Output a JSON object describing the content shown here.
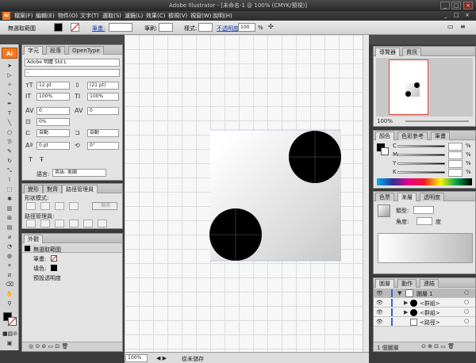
{
  "window": {
    "title": "Adobe Illustrator - [未命名-1 @ 100% (CMYK/預視)]",
    "minimize": "_",
    "maximize": "□",
    "close": "×"
  },
  "menubar": {
    "app_icon": "Ai",
    "items": [
      "檔案(F)",
      "編輯(E)",
      "物件(O)",
      "文字(T)",
      "選取(S)",
      "濾鏡(L)",
      "效果(C)",
      "檢視(V)",
      "視窗(W)",
      "說明(H)"
    ],
    "doc_min": "_",
    "doc_restore": "□",
    "doc_close": "×"
  },
  "controlbar": {
    "selection": "無選取範圍",
    "stroke_label": "筆畫:",
    "brush_label": "筆刷:",
    "style_label": "樣式:",
    "opacity_label": "不透明度:",
    "opacity_value": "100",
    "opacity_unit": "%"
  },
  "colors": {
    "accent": "#f47a20",
    "nav_frame": "#e0413a",
    "link": "#1d49b8"
  },
  "character_panel": {
    "tabs": [
      "字元",
      "段落",
      "OpenType"
    ],
    "font_family": "Adobe 明體 Std L",
    "font_style": "-",
    "size": "12 pt",
    "leading": "(21 pt)",
    "vscale": "100%",
    "hscale": "100%",
    "kerning": "0",
    "tracking": "0",
    "tsume": "0%",
    "aki_left": "自動",
    "aki_right": "自動",
    "baseline": "0 pt",
    "rotation": "0°",
    "language_label": "語言:",
    "language": "英語: 美國"
  },
  "pathfinder_panel": {
    "tabs": [
      "變形",
      "對齊",
      "路徑管理員"
    ],
    "shape_modes_label": "形狀模式:",
    "expand_label": "展開",
    "pathfinders_label": "路徑管理員:"
  },
  "appearance_panel": {
    "tab": "外觀",
    "header": "無選取範圍",
    "stroke_label": "筆畫:",
    "fill_label": "填色:",
    "default_opacity": "預設透明度"
  },
  "navigator_panel": {
    "tabs": [
      "導覽器",
      "資訊"
    ],
    "zoom": "100%"
  },
  "color_panel": {
    "tabs": [
      "顏色",
      "色彩參考",
      "筆畫"
    ],
    "channels": [
      {
        "label": "C",
        "value": "",
        "unit": "%"
      },
      {
        "label": "M",
        "value": "",
        "unit": "%"
      },
      {
        "label": "Y",
        "value": "",
        "unit": "%"
      },
      {
        "label": "K",
        "value": "",
        "unit": "%"
      }
    ]
  },
  "gradient_panel": {
    "tabs": [
      "色票",
      "漸層",
      "透明度"
    ],
    "type_label": "類型:",
    "angle_label": "角度:",
    "angle_unit": "度"
  },
  "layers_panel": {
    "tabs": [
      "圖層",
      "動作",
      "連結"
    ],
    "layers": [
      {
        "name": "圖層 1",
        "level": 0
      },
      {
        "name": "<群組>",
        "level": 1
      },
      {
        "name": "<群組>",
        "level": 1
      },
      {
        "name": "<路徑>",
        "level": 1
      }
    ],
    "count_label": "1 個圖層"
  },
  "statusbar": {
    "zoom": "100%",
    "status_text": "從未儲存"
  }
}
